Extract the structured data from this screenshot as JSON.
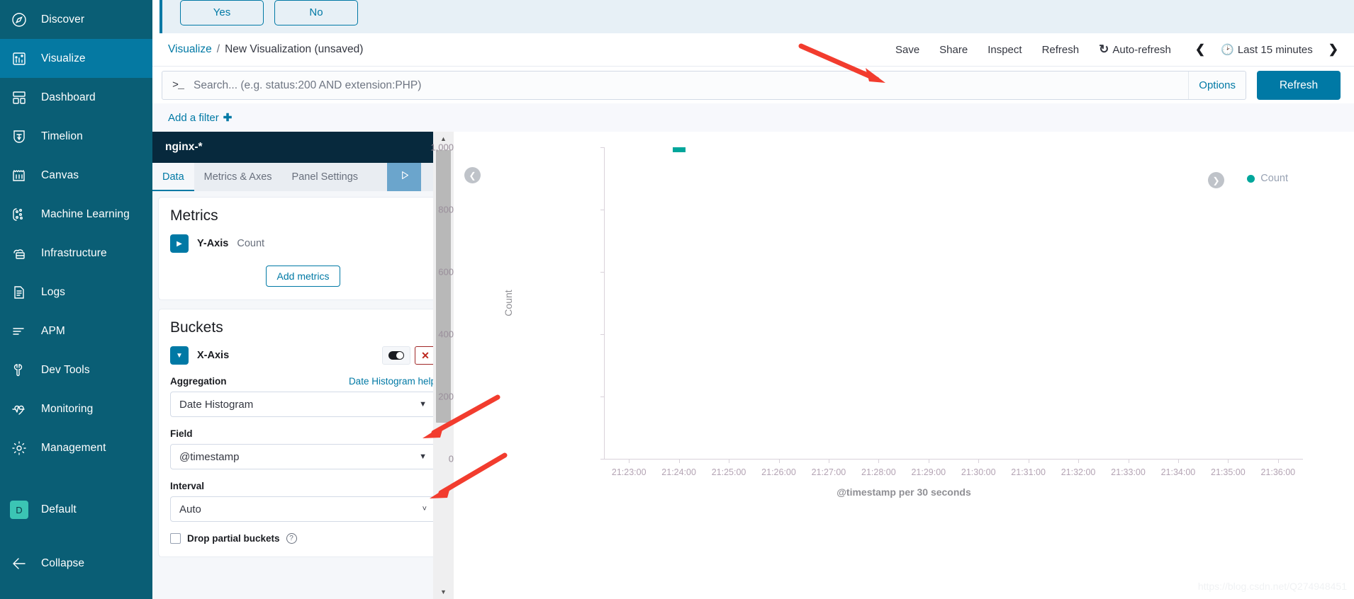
{
  "sidebar": {
    "items": [
      {
        "label": "Discover",
        "icon": "compass-icon",
        "active": false
      },
      {
        "label": "Visualize",
        "icon": "bar-chart-icon",
        "active": true
      },
      {
        "label": "Dashboard",
        "icon": "dashboard-grid-icon",
        "active": false
      },
      {
        "label": "Timelion",
        "icon": "timelion-shield-icon",
        "active": false
      },
      {
        "label": "Canvas",
        "icon": "canvas-icon",
        "active": false
      },
      {
        "label": "Machine Learning",
        "icon": "machine-learning-icon",
        "active": false
      },
      {
        "label": "Infrastructure",
        "icon": "infrastructure-icon",
        "active": false
      },
      {
        "label": "Logs",
        "icon": "logs-document-icon",
        "active": false
      },
      {
        "label": "APM",
        "icon": "apm-lines-icon",
        "active": false
      },
      {
        "label": "Dev Tools",
        "icon": "wrench-icon",
        "active": false
      },
      {
        "label": "Monitoring",
        "icon": "heartbeat-icon",
        "active": false
      },
      {
        "label": "Management",
        "icon": "gear-icon",
        "active": false
      }
    ],
    "space": {
      "badge": "D",
      "label": "Default"
    },
    "collapse": {
      "label": "Collapse",
      "icon": "arrow-left-icon"
    }
  },
  "banner": {
    "yes_label": "Yes",
    "no_label": "No"
  },
  "breadcrumb": {
    "root": "Visualize",
    "separator": "/",
    "current": "New Visualization (unsaved)"
  },
  "topactions": {
    "save": "Save",
    "share": "Share",
    "inspect": "Inspect",
    "refresh": "Refresh",
    "auto_refresh": "Auto-refresh",
    "auto_refresh_icon": "refresh-circle-icon",
    "prev_icon": "chevron-left-icon",
    "next_icon": "chevron-right-icon",
    "time_icon": "clock-icon",
    "time_range": "Last 15 minutes"
  },
  "query": {
    "prompt": ">_",
    "value": "",
    "placeholder": "Search... (e.g. status:200 AND extension:PHP)",
    "options_label": "Options",
    "refresh_label": "Refresh"
  },
  "filters": {
    "add_filter_label": "Add a filter",
    "plus_icon": "plus-icon"
  },
  "editor": {
    "index_pattern": "nginx-*",
    "tabs": [
      {
        "label": "Data",
        "active": true
      },
      {
        "label": "Metrics & Axes",
        "active": false
      },
      {
        "label": "Panel Settings",
        "active": false
      }
    ],
    "apply_icon": "play-triangle-icon",
    "close_icon": "close-x-icon",
    "metrics": {
      "title": "Metrics",
      "agg_name": "Y-Axis",
      "agg_value": "Count",
      "expand_icon": "caret-right-icon",
      "add_metrics_label": "Add metrics"
    },
    "buckets": {
      "title": "Buckets",
      "agg_name": "X-Axis",
      "collapse_icon": "caret-down-icon",
      "toggle_icon": "visibility-toggle-icon",
      "delete_icon": "remove-x-icon",
      "aggregation_label": "Aggregation",
      "aggregation_help": "Date Histogram help",
      "aggregation_value": "Date Histogram",
      "field_label": "Field",
      "field_value": "@timestamp",
      "interval_label": "Interval",
      "interval_value": "Auto",
      "drop_partial_label": "Drop partial buckets",
      "drop_partial_checked": false,
      "help_icon": "question-circle-icon"
    },
    "scrollbar": {
      "up_icon": "triangle-up-icon",
      "down_icon": "triangle-down-icon"
    }
  },
  "chart_panel": {
    "collapse_left_icon": "chevron-left-circle-icon",
    "legend_toggle_icon": "chevron-right-circle-icon"
  },
  "chart_data": {
    "type": "bar",
    "title": "",
    "xlabel": "@timestamp per 30 seconds",
    "ylabel": "Count",
    "ylim": [
      0,
      1000
    ],
    "ytick_labels": [
      "0",
      "200",
      "400",
      "600",
      "800",
      "1,000"
    ],
    "ytick_values": [
      0,
      200,
      400,
      600,
      800,
      1000
    ],
    "categories": [
      "21:23:00",
      "21:24:00",
      "21:25:00",
      "21:26:00",
      "21:27:00",
      "21:28:00",
      "21:29:00",
      "21:30:00",
      "21:31:00",
      "21:32:00",
      "21:33:00",
      "21:34:00",
      "21:35:00",
      "21:36:00"
    ],
    "series": [
      {
        "name": "Count",
        "color": "#00a69b",
        "points": [
          {
            "x": "21:24:00",
            "y": 1000
          }
        ]
      }
    ],
    "legend": {
      "position": "top-right",
      "entries": [
        {
          "label": "Count",
          "color": "#00a69b"
        }
      ]
    },
    "grid": false
  },
  "annotations": [
    {
      "name": "arrow-to-save",
      "target": "Save"
    },
    {
      "name": "arrow-to-aggregation",
      "target": "Date Histogram"
    },
    {
      "name": "arrow-to-field",
      "target": "@timestamp"
    }
  ],
  "watermark": "https://blog.csdn.net/Q274948451",
  "colors": {
    "sidebar_bg": "#0a5e75",
    "sidebar_active": "#0579a2",
    "accent": "#0079a5",
    "series": "#00a69b",
    "danger": "#bd271e",
    "space_badge": "#3bc5b4"
  }
}
